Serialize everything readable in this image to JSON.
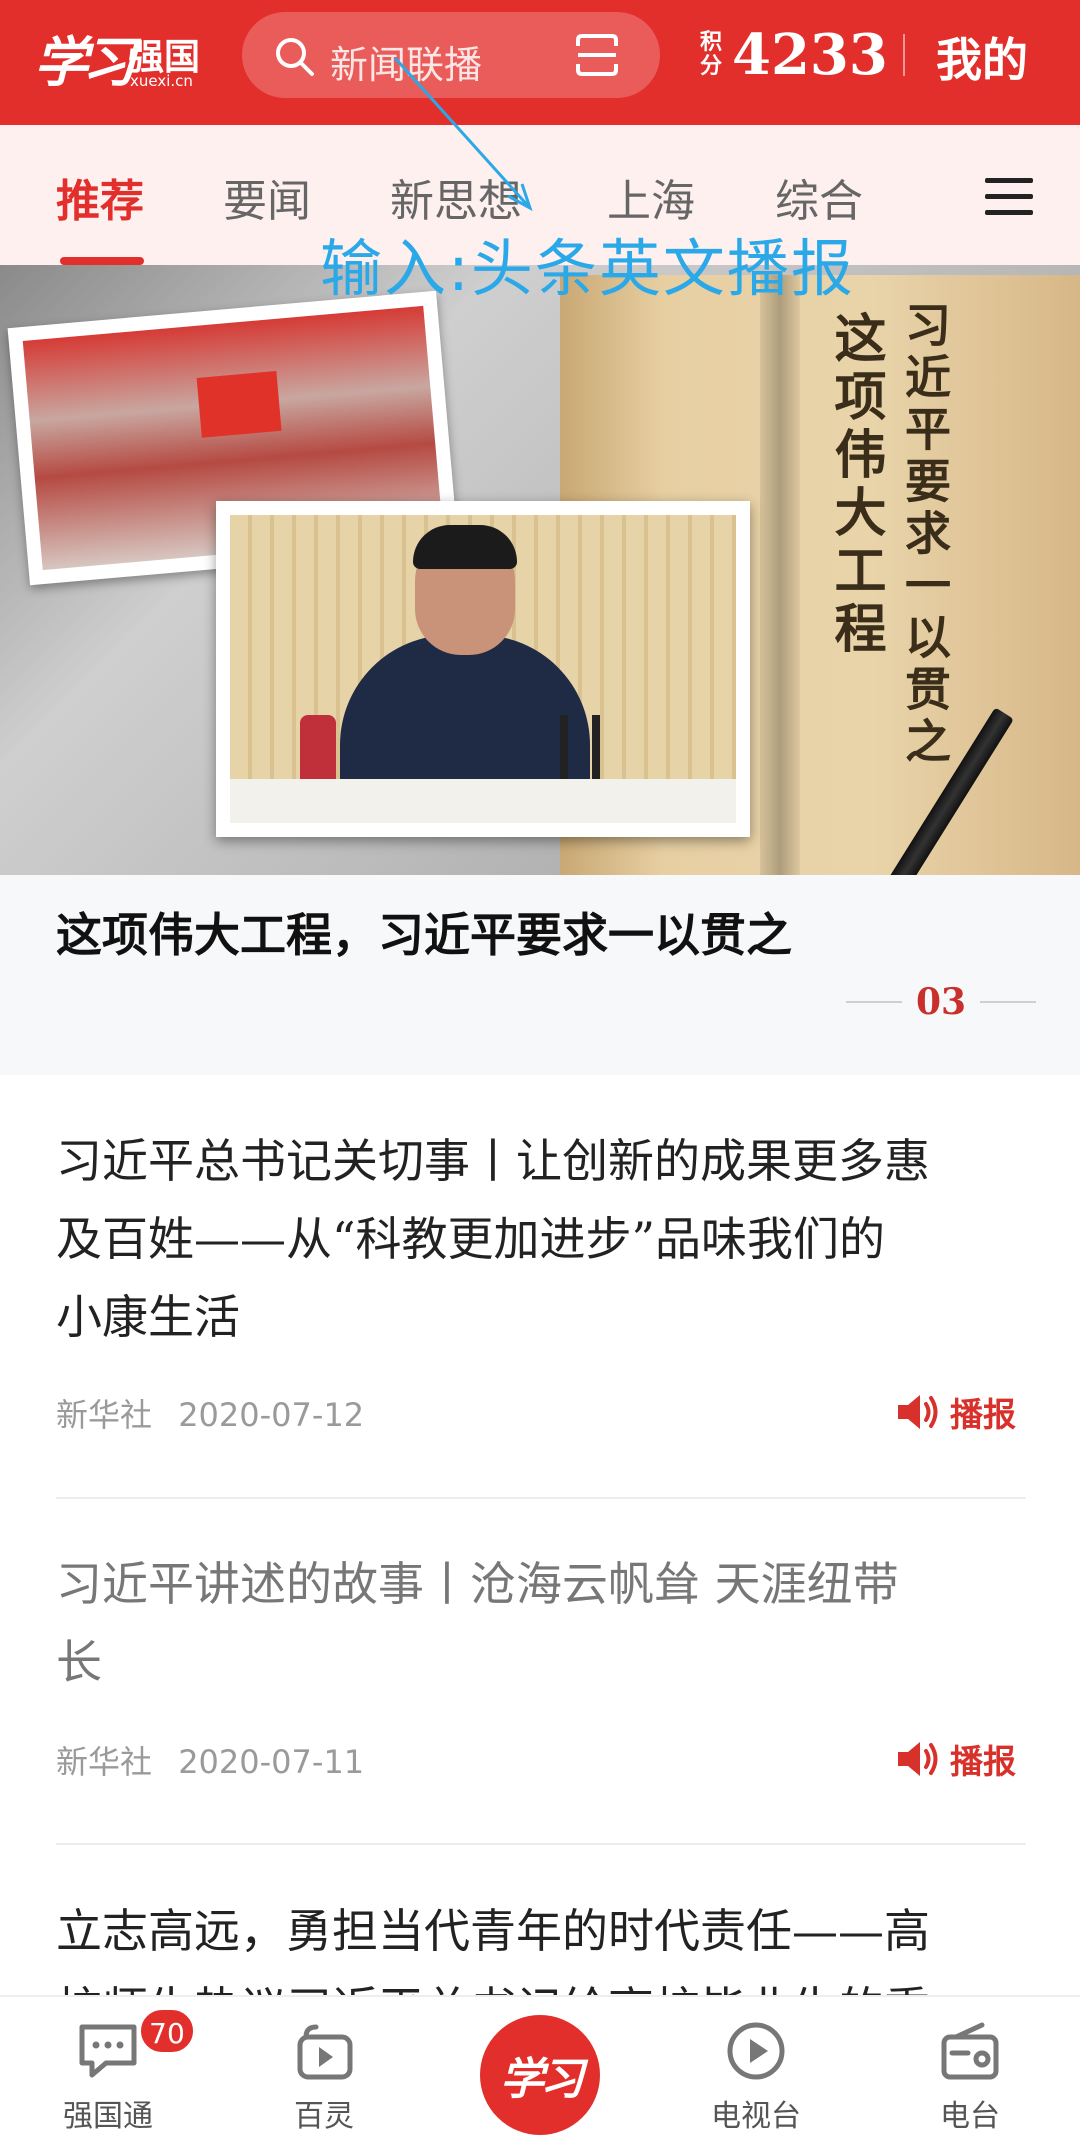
{
  "header": {
    "logo_main": "学习",
    "logo_sub": "强国",
    "logo_url": "xuexi.cn",
    "search_placeholder": "新闻联播",
    "points_label_top": "积",
    "points_label_bottom": "分",
    "points_value": "4233",
    "mine_label": "我的",
    "brand_color": "#e32f2b"
  },
  "tabs": [
    {
      "label": "推荐",
      "active": true
    },
    {
      "label": "要闻",
      "active": false
    },
    {
      "label": "新思想",
      "active": false
    },
    {
      "label": "上海",
      "active": false
    },
    {
      "label": "综合",
      "active": false
    }
  ],
  "annotation": {
    "text": "输入:头条英文播报",
    "color": "#2aa8e8"
  },
  "banner": {
    "vertical_text_1": "这项伟大工程",
    "vertical_text_2": "习近平要求一以贯之"
  },
  "headline": {
    "title": "这项伟大工程，习近平要求一以贯之",
    "page": "03"
  },
  "articles": [
    {
      "title_lines": [
        "习近平总书记关切事丨让创新的成果更多惠",
        "及百姓——从“科教更加进步”品味我们的",
        "小康生活"
      ],
      "source": "新华社",
      "date": "2020-07-12",
      "broadcast_label": "播报"
    },
    {
      "title_lines": [
        "习近平讲述的故事丨沧海云帆耸 天涯纽带",
        "长"
      ],
      "source": "新华社",
      "date": "2020-07-11",
      "broadcast_label": "播报"
    },
    {
      "title_lines": [
        "立志高远，勇担当代青年的时代责任——高",
        "校师生热议习近平总书记给高校毕业生的重"
      ]
    }
  ],
  "bottom_nav": {
    "items": [
      {
        "label": "强国通",
        "icon": "chat-icon",
        "badge": "70"
      },
      {
        "label": "百灵",
        "icon": "video-bag-icon"
      },
      {
        "label": "学习",
        "icon": "xuexi-logo"
      },
      {
        "label": "电视台",
        "icon": "play-circle-icon"
      },
      {
        "label": "电台",
        "icon": "radio-icon"
      }
    ]
  }
}
